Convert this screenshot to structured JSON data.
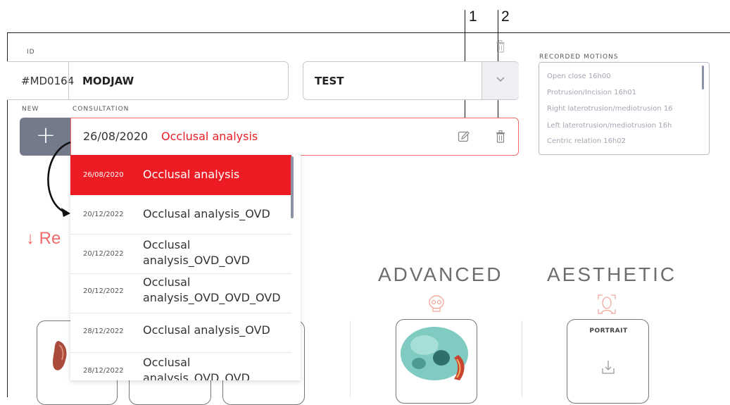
{
  "callouts": [
    "1",
    "2"
  ],
  "patient": {
    "id_label": "ID",
    "id_value": "#MD0164",
    "name": "MODJAW",
    "dropdown_value": "TEST"
  },
  "recorded_motions": {
    "label": "RECORDED MOTIONS",
    "items": [
      "Open close 16h00",
      "Protrusion/Incision 16h01",
      "Right laterotrusion/mediotrusion 16",
      "Left laterotrusion/mediotrusion 16h",
      "Centric relation 16h02"
    ]
  },
  "consultation": {
    "new_label": "NEW",
    "label": "CONSULTATION",
    "current_date": "26/08/2020",
    "current_name": "Occlusal analysis",
    "new_button": "+"
  },
  "dropdown_items": [
    {
      "date": "26/08/2020",
      "name": "Occlusal analysis",
      "selected": true
    },
    {
      "date": "20/12/2022",
      "name": "Occlusal analysis_OVD"
    },
    {
      "date": "20/12/2022",
      "name": "Occlusal analysis_OVD_OVD"
    },
    {
      "date": "20/12/2022",
      "name": "Occlusal analysis_OVD_OVD_OVD"
    },
    {
      "date": "28/12/2022",
      "name": "Occlusal analysis_OVD"
    },
    {
      "date": "28/12/2022",
      "name": "Occlusal analysis_OVD_OVD"
    }
  ],
  "partial_heading": "↓ Re",
  "sections": {
    "advanced": "ADVANCED",
    "aesthetic": "AESTHETIC",
    "portrait_label": "PORTRAIT"
  },
  "colors": {
    "accent_red": "#ed1c24",
    "new_button_gray": "#737a8a",
    "motions_text": "#a4a7b3"
  }
}
